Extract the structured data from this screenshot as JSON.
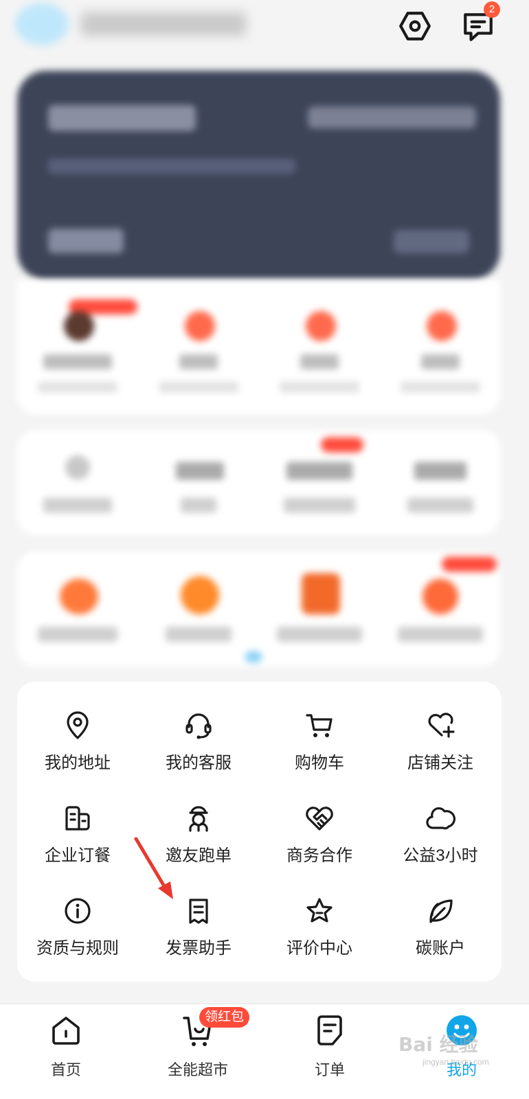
{
  "header": {
    "message_badge": "2",
    "icons": {
      "settings": "settings-hex-icon",
      "messages": "message-bubble-icon"
    }
  },
  "services": {
    "items": [
      {
        "label": "我的地址",
        "icon": "location-pin-icon"
      },
      {
        "label": "我的客服",
        "icon": "headset-icon"
      },
      {
        "label": "购物车",
        "icon": "shopping-cart-icon"
      },
      {
        "label": "店铺关注",
        "icon": "heart-plus-icon"
      },
      {
        "label": "企业订餐",
        "icon": "building-icon"
      },
      {
        "label": "邀友跑单",
        "icon": "courier-icon"
      },
      {
        "label": "商务合作",
        "icon": "handshake-icon"
      },
      {
        "label": "公益3小时",
        "icon": "cloud-icon"
      },
      {
        "label": "资质与规则",
        "icon": "info-icon"
      },
      {
        "label": "发票助手",
        "icon": "receipt-icon"
      },
      {
        "label": "评价中心",
        "icon": "star-icon"
      },
      {
        "label": "碳账户",
        "icon": "leaf-icon"
      }
    ]
  },
  "bottom_nav": {
    "items": [
      {
        "label": "首页",
        "icon": "home-icon"
      },
      {
        "label": "全能超市",
        "icon": "supermarket-cart-icon"
      },
      {
        "label": "订单",
        "icon": "order-doc-icon"
      },
      {
        "label": "我的",
        "icon": "profile-icon"
      }
    ],
    "badge": "领红包",
    "active_color": "#12a6e8"
  },
  "watermark": {
    "main": "Bai 经验",
    "sub": "jingyan.baidu.com"
  },
  "colors": {
    "accent": "#12a6e8",
    "badge": "#ff4b3a",
    "card_dark": "#3d4458"
  }
}
